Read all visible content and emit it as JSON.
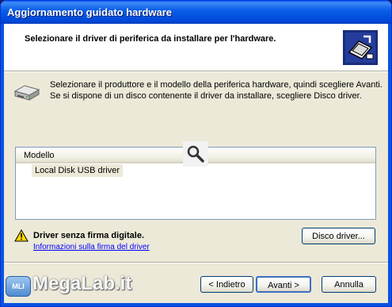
{
  "window": {
    "title": "Aggiornamento guidato hardware"
  },
  "header": {
    "title": "Selezionare il driver di periferica da installare per l'hardware."
  },
  "instructions": {
    "text": "Selezionare il produttore e il modello della periferica hardware, quindi scegliere Avanti. Se si dispone di un disco contenente il driver da installare, scegliere Disco driver."
  },
  "list": {
    "column_header": "Modello",
    "items": [
      {
        "label": "Local Disk USB driver"
      }
    ]
  },
  "warning": {
    "title": "Driver senza firma digitale.",
    "link": "Informazioni sulla firma del driver"
  },
  "buttons": {
    "disk": "Disco driver...",
    "back": "< Indietro",
    "next": "Avanti >",
    "cancel": "Annulla"
  },
  "watermark": {
    "badge": "MLI",
    "text": "MegaLab.it"
  },
  "colors": {
    "titlebar": "#0a5fe8",
    "dialog_bg": "#ece9d8",
    "link": "#0000ff"
  },
  "icons": {
    "header": "hardware-chip-icon",
    "instructions": "disk-drive-icon",
    "search": "magnifier-icon",
    "warning": "warning-icon"
  }
}
